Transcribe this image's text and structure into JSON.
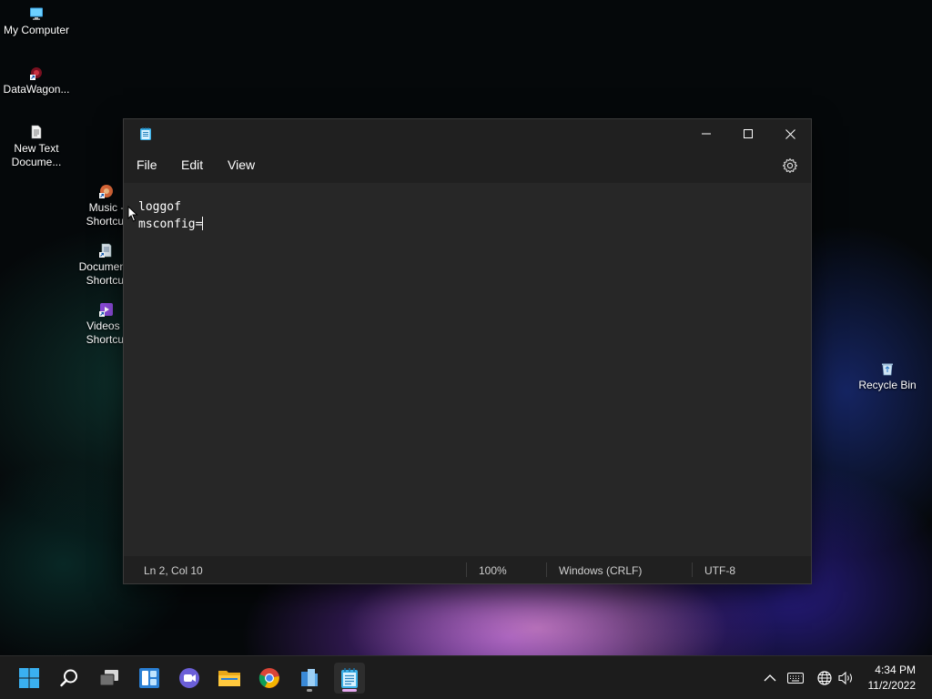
{
  "desktop": {
    "icons": [
      {
        "label": "My Computer",
        "icon": "monitor-icon"
      },
      {
        "label": "DataWagon...",
        "icon": "datawagon-shortcut-icon"
      },
      {
        "label": "New Text\nDocume...",
        "icon": "text-file-icon"
      },
      {
        "label": "Music -\nShortcut",
        "icon": "music-shortcut-icon"
      },
      {
        "label": "Documents\nShortcut",
        "icon": "documents-shortcut-icon"
      },
      {
        "label": "Videos -\nShortcut",
        "icon": "videos-shortcut-icon"
      },
      {
        "label": "Recycle Bin",
        "icon": "recycle-bin-icon"
      }
    ]
  },
  "notepad": {
    "menu": [
      "File",
      "Edit",
      "View"
    ],
    "content_lines": [
      "loggof",
      "msconfig="
    ],
    "status": {
      "position": "Ln 2, Col 10",
      "zoom": "100%",
      "line_ending": "Windows (CRLF)",
      "encoding": "UTF-8"
    }
  },
  "taskbar": {
    "apps": [
      "start-icon",
      "search-icon",
      "task-view-icon",
      "widgets-icon",
      "teams-chat-icon",
      "file-explorer-icon",
      "chrome-icon",
      "network-app-icon",
      "notepad-icon"
    ],
    "clock": {
      "time": "4:34 PM",
      "date": "11/2/2022"
    }
  },
  "colors": {
    "accent": "#4cc2ff",
    "window_bg": "#202020",
    "editor_bg": "#272727",
    "taskbar_bg": "#1c1c1c"
  }
}
